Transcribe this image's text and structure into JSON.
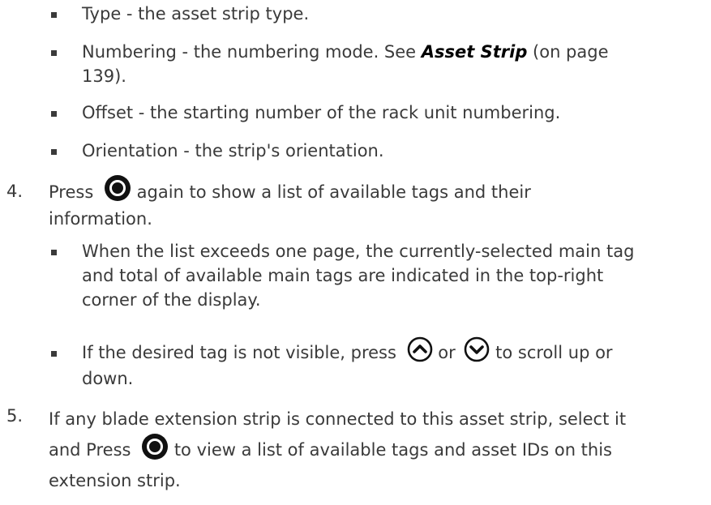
{
  "bullets_top": [
    {
      "text": "Type - the asset strip type."
    },
    {
      "pre": "Numbering - the numbering mode. See ",
      "link": "Asset Strip",
      "post": " (on page",
      "line2": "139)."
    },
    {
      "text": "Offset - the starting number of the rack unit numbering."
    },
    {
      "text": "Orientation - the strip's orientation."
    }
  ],
  "step4": {
    "number": "4.",
    "pre": "Press",
    "post": " again to show a list of available tags and their",
    "line2": "information.",
    "icon": "ok-button-icon",
    "bullets": [
      {
        "line1": "When the list exceeds one page, the currently-selected main tag",
        "line2": "and total of available main tags are indicated in the top-right",
        "line3": "corner of the display."
      },
      {
        "pre": "If the desired tag is not visible, press",
        "mid": " or ",
        "post": " to scroll up or",
        "line2": "down.",
        "icon_up": "up-arrow-button-icon",
        "icon_down": "down-arrow-button-icon"
      }
    ]
  },
  "step5": {
    "number": "5.",
    "line1": "If any blade extension strip is connected to this asset strip, select it",
    "pre": "and Press",
    "post": " to view a list of available tags and asset IDs on this",
    "line3": "extension strip.",
    "icon": "ok-button-icon"
  }
}
